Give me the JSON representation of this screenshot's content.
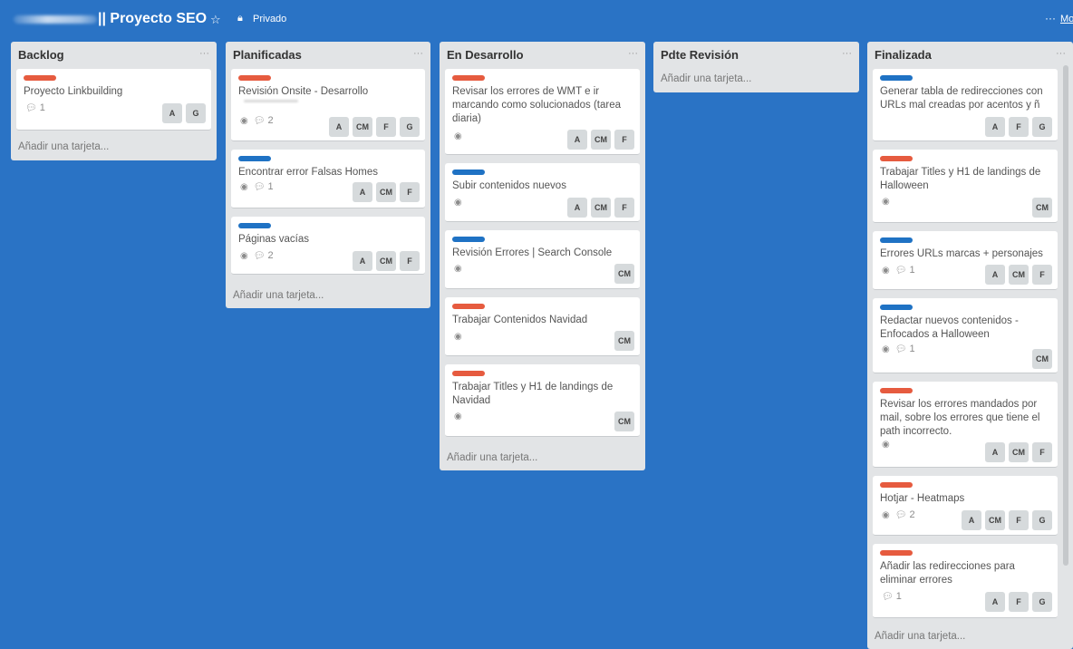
{
  "board": {
    "title": "|| Proyecto SEO",
    "star_icon": "star-icon",
    "privacy": "Privado",
    "privacy_icon": "lock-icon",
    "menu_dots": "···",
    "more_link": "Mo"
  },
  "colors": {
    "board_bg": "#2a73c5",
    "label_red": "#e65b3f",
    "label_blue": "#1f72c4"
  },
  "add_card_label": "Añadir una tarjeta...",
  "lists": [
    {
      "title": "Backlog",
      "menu": "···",
      "cards": [
        {
          "label": "red",
          "title": "Proyecto Linkbuilding",
          "comments": "1",
          "members": [
            "A",
            "G"
          ]
        }
      ]
    },
    {
      "title": "Planificadas",
      "menu": "···",
      "cards": [
        {
          "label": "red",
          "title": "Revisión Onsite - Desarrollo",
          "watch": true,
          "comments": "2",
          "members": [
            "A",
            "CM",
            "F",
            "G"
          ]
        },
        {
          "label": "blue",
          "title": "Encontrar error Falsas Homes",
          "watch": true,
          "comments": "1",
          "members": [
            "A",
            "CM",
            "F"
          ]
        },
        {
          "label": "blue",
          "title": "Páginas vacías",
          "watch": true,
          "comments": "2",
          "members": [
            "A",
            "CM",
            "F"
          ]
        }
      ]
    },
    {
      "title": "En Desarrollo",
      "menu": "···",
      "cards": [
        {
          "label": "red",
          "title": "Revisar los errores de WMT e ir marcando como solucionados (tarea diaria)",
          "watch": true,
          "members": [
            "A",
            "CM",
            "F"
          ]
        },
        {
          "label": "blue",
          "title": "Subir contenidos nuevos",
          "watch": true,
          "members": [
            "A",
            "CM",
            "F"
          ]
        },
        {
          "label": "blue",
          "title": "Revisión Errores | Search Console",
          "watch": true,
          "members": [
            "CM"
          ]
        },
        {
          "label": "red",
          "title": "Trabajar Contenidos Navidad",
          "watch": true,
          "members": [
            "CM"
          ]
        },
        {
          "label": "red",
          "title": "Trabajar Titles y H1 de landings de Navidad",
          "watch": true,
          "members": [
            "CM"
          ]
        }
      ]
    },
    {
      "title": "Pdte Revisión",
      "menu": "···",
      "cards": []
    },
    {
      "title": "Finalizada",
      "menu": "···",
      "cards": [
        {
          "label": "blue",
          "title": "Generar tabla de redirecciones con URLs mal creadas por acentos y ñ",
          "members": [
            "A",
            "F",
            "G"
          ]
        },
        {
          "label": "red",
          "title": "Trabajar Titles y H1 de landings de Halloween",
          "watch": true,
          "members": [
            "CM"
          ]
        },
        {
          "label": "blue",
          "title": "Errores URLs marcas + personajes",
          "watch": true,
          "comments": "1",
          "members": [
            "A",
            "CM",
            "F"
          ]
        },
        {
          "label": "blue",
          "title": "Redactar nuevos contenidos - Enfocados a Halloween",
          "watch": true,
          "comments": "1",
          "members": [
            "CM"
          ]
        },
        {
          "label": "red",
          "title": "Revisar los errores mandados por mail, sobre los errores que tiene el path incorrecto.",
          "watch": true,
          "members": [
            "A",
            "CM",
            "F"
          ]
        },
        {
          "label": "red",
          "title": "Hotjar - Heatmaps",
          "watch": true,
          "comments": "2",
          "members": [
            "A",
            "CM",
            "F",
            "G"
          ]
        },
        {
          "label": "red",
          "title": "Añadir las redirecciones para eliminar errores",
          "comments": "1",
          "members": [
            "A",
            "F",
            "G"
          ]
        }
      ]
    }
  ]
}
